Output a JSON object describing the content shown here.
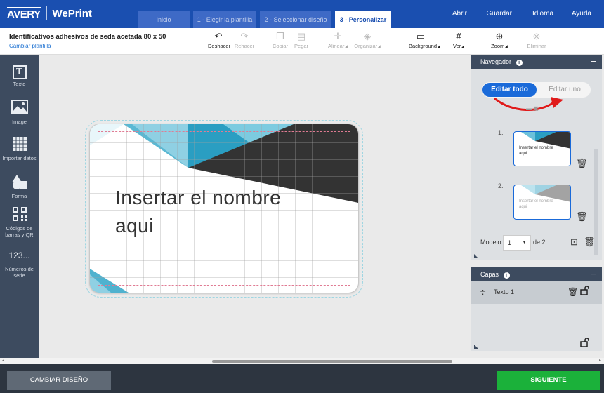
{
  "header": {
    "logo_avery": "AVERY",
    "logo_weprint": "WePrint",
    "steps": [
      {
        "label": "Inicio"
      },
      {
        "label": "1 - Elegir la plantilla"
      },
      {
        "label": "2 - Seleccionar diseño"
      },
      {
        "label": "3 - Personalizar"
      }
    ],
    "menu": [
      "Abrir",
      "Guardar",
      "Idioma",
      "Ayuda"
    ],
    "active_step": "3 - Personalizar"
  },
  "toolbar": {
    "title": "Identificativos adhesivos de seda acetada 80 x 50",
    "change_template": "Cambiar plantilla",
    "tools": [
      {
        "label": "Deshacer",
        "icon": "undo-icon",
        "enabled": true
      },
      {
        "label": "Rehacer",
        "icon": "redo-icon",
        "enabled": false
      },
      {
        "label": "Copiar",
        "icon": "copy-icon",
        "enabled": false
      },
      {
        "label": "Pegar",
        "icon": "paste-icon",
        "enabled": false
      },
      {
        "label": "Alinear",
        "icon": "align-icon",
        "enabled": false
      },
      {
        "label": "Organizar",
        "icon": "arrange-icon",
        "enabled": false
      },
      {
        "label": "Background",
        "icon": "background-icon",
        "enabled": true
      },
      {
        "label": "Ver",
        "icon": "grid-icon",
        "enabled": true
      },
      {
        "label": "Zoom",
        "icon": "zoom-icon",
        "enabled": true
      },
      {
        "label": "Eliminar",
        "icon": "delete-icon",
        "enabled": false
      }
    ]
  },
  "sidebar": {
    "items": [
      {
        "label": "Texto",
        "icon": "text-icon"
      },
      {
        "label": "Image",
        "icon": "image-icon"
      },
      {
        "label": "Importar datos",
        "icon": "import-data-icon"
      },
      {
        "label": "Forma",
        "icon": "shape-icon"
      },
      {
        "label": "Códigos de barras y QR",
        "icon": "qr-code-icon"
      },
      {
        "label": "Números de serie",
        "icon": "serial-number-icon"
      }
    ]
  },
  "canvas": {
    "label_text": "Insertar el nombre aqui",
    "label_text_line1": "Insertar el nombre",
    "label_text_line2": "aqui"
  },
  "navigator": {
    "title": "Navegador",
    "toggle_on": "Editar todo",
    "toggle_off": "Editar uno",
    "thumbnails": [
      {
        "number": "1.",
        "text": "Insertar el nombre aqui",
        "line1": "Insertar el nombre",
        "line2": "aqui"
      },
      {
        "number": "2.",
        "text": "Insertar el nombre aqui",
        "line1": "Insertar el nombre",
        "line2": "aqui"
      }
    ],
    "modelo_label": "Modelo",
    "modelo_value": "1",
    "modelo_total": "de 2"
  },
  "layers": {
    "title": "Capas",
    "items": [
      {
        "name": "Texto 1"
      }
    ]
  },
  "footer": {
    "change_design": "CAMBIAR DISEÑO",
    "next": "SIGUIENTE"
  },
  "colors": {
    "brand_blue": "#1a4fb0",
    "accent_blue": "#1a6ad9",
    "sidebar": "#3d4b5f",
    "teal": "#3ba8c6",
    "dark_triangle": "#3a3a3a",
    "next_green": "#1bb13a"
  }
}
